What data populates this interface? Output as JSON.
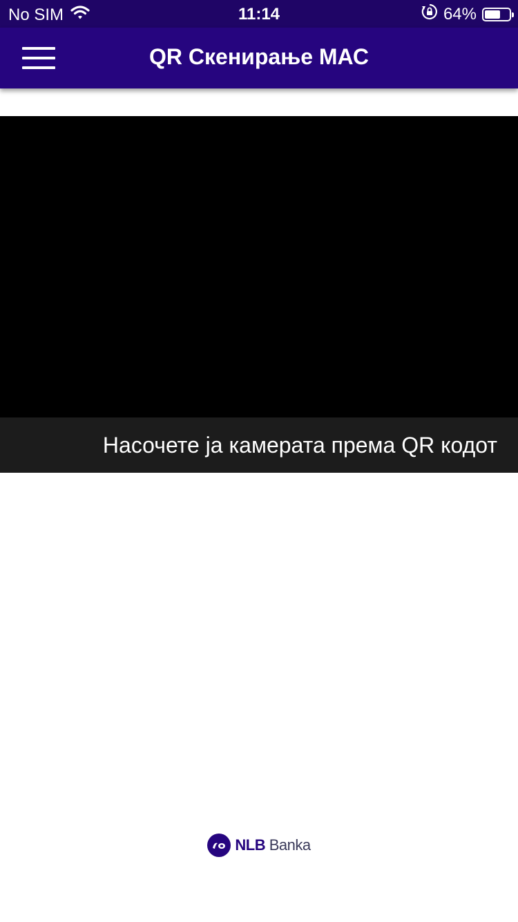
{
  "status_bar": {
    "carrier": "No SIM",
    "time": "11:14",
    "battery_percent": "64%",
    "battery_level": 0.64,
    "icons": [
      "wifi-icon",
      "rotation-lock-icon",
      "battery-icon"
    ]
  },
  "header": {
    "title": "QR Скенирање МАС",
    "menu_icon": "hamburger-menu-icon"
  },
  "scanner": {
    "hint": "Насочете ја камерата према QR кодот"
  },
  "brand": {
    "name_bold": "NLB",
    "name_light": "Banka",
    "color": "#26057f"
  },
  "colors": {
    "status_bar": "#1f0566",
    "app_bar": "#26057f",
    "camera_bg": "#000000",
    "hint_bg": "#1c1c1c"
  }
}
